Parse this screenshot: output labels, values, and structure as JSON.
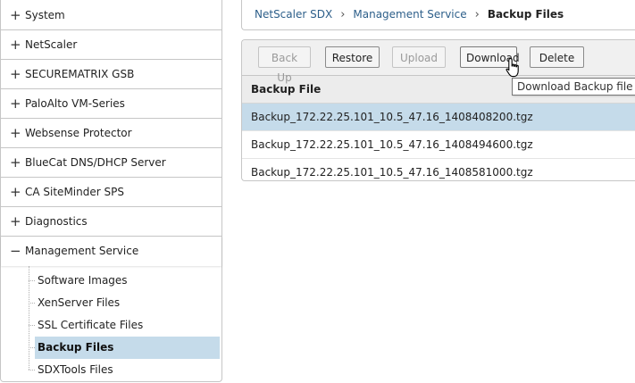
{
  "sidebar": {
    "items": [
      {
        "label": "System",
        "expander": "+"
      },
      {
        "label": "NetScaler",
        "expander": "+"
      },
      {
        "label": "SECUREMATRIX GSB",
        "expander": "+"
      },
      {
        "label": "PaloAlto VM-Series",
        "expander": "+"
      },
      {
        "label": "Websense Protector",
        "expander": "+"
      },
      {
        "label": "BlueCat DNS/DHCP Server",
        "expander": "+"
      },
      {
        "label": "CA SiteMinder SPS",
        "expander": "+"
      },
      {
        "label": "Diagnostics",
        "expander": "+"
      },
      {
        "label": "Management Service",
        "expander": "−"
      }
    ],
    "subitems": [
      {
        "label": "Software Images"
      },
      {
        "label": "XenServer Files"
      },
      {
        "label": "SSL Certificate Files"
      },
      {
        "label": "Backup Files",
        "selected": true
      },
      {
        "label": "SDXTools Files"
      }
    ]
  },
  "breadcrumb": {
    "items": [
      "NetScaler SDX",
      "Management Service"
    ],
    "current": "Backup Files",
    "separator": "›"
  },
  "toolbar": {
    "back_up_label": "Back Up",
    "restore_label": "Restore",
    "upload_label": "Upload",
    "download_label": "Download",
    "delete_label": "Delete"
  },
  "table": {
    "column_header": "Backup File",
    "rows": [
      {
        "name": "Backup_172.22.25.101_10.5_47.16_1408408200.tgz",
        "selected": true
      },
      {
        "name": "Backup_172.22.25.101_10.5_47.16_1408494600.tgz",
        "selected": false
      },
      {
        "name": "Backup_172.22.25.101_10.5_47.16_1408581000.tgz",
        "selected": false
      }
    ]
  },
  "tooltip": {
    "text": "Download Backup file"
  },
  "colors": {
    "selection": "#c5dbea",
    "link": "#2d5f8a",
    "border": "#c6c6c6",
    "toolbar_bg": "#f0f0f0"
  },
  "icons": {
    "cursor": "hand-pointer-icon"
  }
}
